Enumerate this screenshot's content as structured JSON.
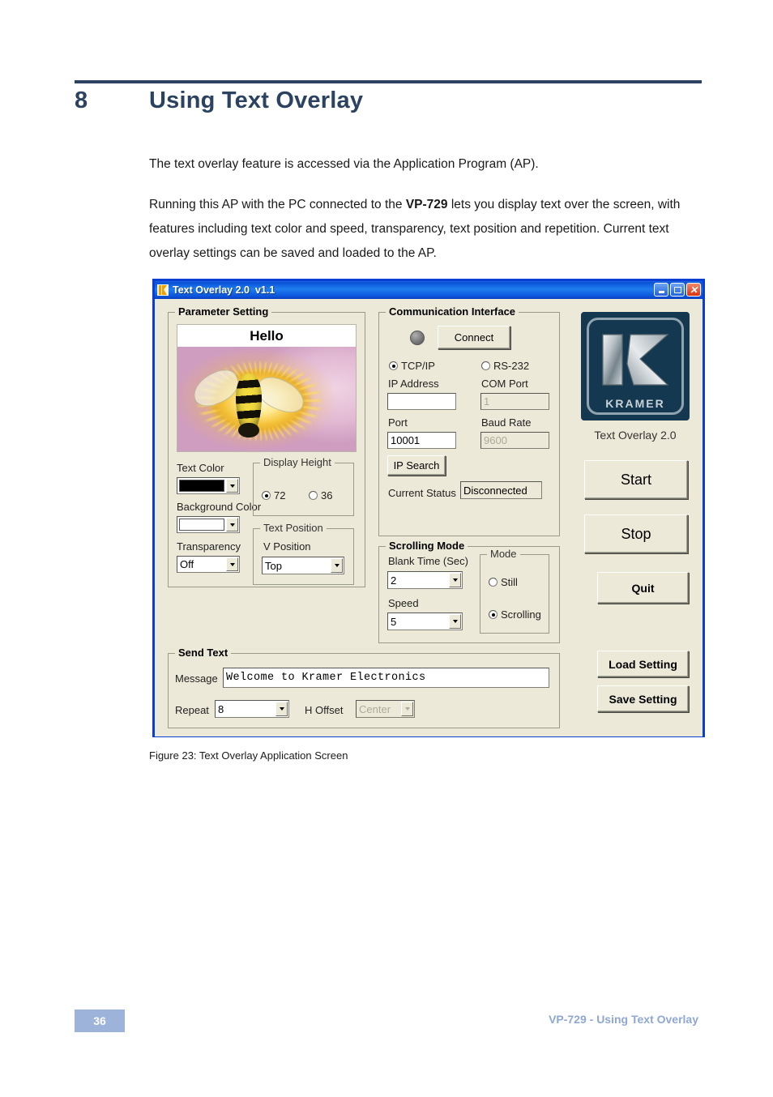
{
  "document": {
    "chapter_number": "8",
    "chapter_title": "Using Text Overlay",
    "paragraph_1": "The text overlay feature is accessed via the Application Program (AP).",
    "paragraph_2": "Running this AP with the PC connected to the VP-729 lets you display text over the screen, with features including text color and speed, transparency, text position and repetition. Current text overlay settings can be saved and loaded to the AP.",
    "paragraph_2_bold_term": "VP-729",
    "figure_caption": "Figure 23: Text Overlay Application Screen",
    "footer_page": "36",
    "footer_title": "VP-729 - Using Text Overlay",
    "accent_color": "#2b4260",
    "footer_box_color": "#9db3da"
  },
  "window": {
    "title": "Text Overlay 2.0  v1.1",
    "border_color": "#0a3fd4",
    "titlebar_color": "#0a51d8",
    "face_color": "#ece9d8",
    "minimize_label": "_",
    "maximize_label": "",
    "close_label": "✕"
  },
  "parameter_setting": {
    "group_title": "Parameter Setting",
    "preview_banner_text": "Hello",
    "text_color_label": "Text Color",
    "text_color_value": "#000000",
    "background_color_label": "Background Color",
    "background_color_value": "#ffffff",
    "transparency_label": "Transparency",
    "transparency_value": "Off",
    "display_height": {
      "group_title": "Display Height",
      "option_1": "72",
      "option_2": "36",
      "selected": "72"
    },
    "text_position": {
      "group_title": "Text Position",
      "v_position_label": "V Position",
      "v_position_value": "Top"
    }
  },
  "communication_interface": {
    "group_title": "Communication Interface",
    "connect_button": "Connect",
    "tcpip_label": "TCP/IP",
    "rs232_label": "RS-232",
    "selected_protocol": "TCP/IP",
    "ip_address_label": "IP Address",
    "ip_address_value": "",
    "com_port_label": "COM Port",
    "com_port_value": "1",
    "port_label": "Port",
    "port_value": "10001",
    "baud_rate_label": "Baud Rate",
    "baud_rate_value": "9600",
    "ip_search_button": "IP Search",
    "current_status_label": "Current Status",
    "current_status_value": "Disconnected",
    "led_color": "#707070"
  },
  "scrolling_mode": {
    "group_title": "Scrolling Mode",
    "blank_time_label": "Blank Time (Sec)",
    "blank_time_value": "2",
    "speed_label": "Speed",
    "speed_value": "5",
    "mode": {
      "group_title": "Mode",
      "option_still": "Still",
      "option_scrolling": "Scrolling",
      "selected": "Scrolling"
    }
  },
  "send_text": {
    "group_title": "Send Text",
    "message_label": "Message",
    "message_value": "Welcome to Kramer Electronics",
    "repeat_label": "Repeat",
    "repeat_value": "8",
    "h_offset_label": "H Offset",
    "h_offset_value": "Center"
  },
  "side_panel": {
    "logo_word": "KRAMER",
    "logo_caption": "Text Overlay 2.0",
    "start_button": "Start",
    "stop_button": "Stop",
    "quit_button": "Quit",
    "load_setting_button": "Load Setting",
    "save_setting_button": "Save Setting"
  }
}
